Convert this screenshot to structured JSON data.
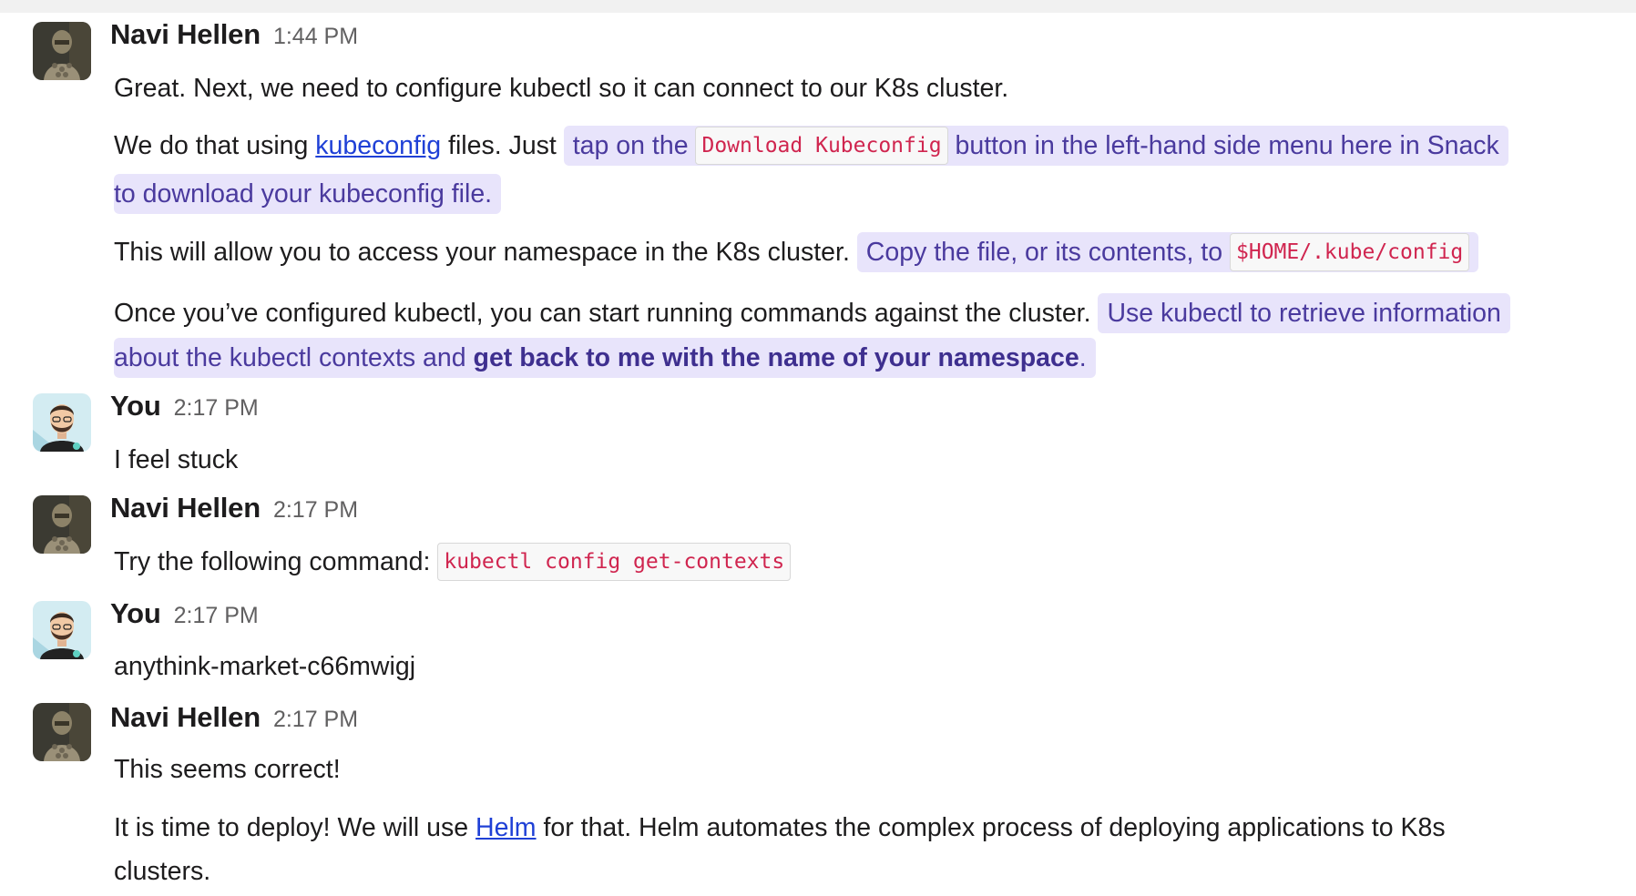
{
  "messages": [
    {
      "author": "Navi Hellen",
      "time": "1:44 PM",
      "lines": {
        "l1": "Great. Next, we need to configure kubectl so it can connect to our K8s cluster.",
        "l2a": "We do that using ",
        "l2link": "kubeconfig",
        "l2b": " files. Just ",
        "l2hl1": "tap on the ",
        "l2code": "Download Kubeconfig",
        "l2hl2": " button in the left-hand side menu here in Snack",
        "l3hl": "to download your kubeconfig file.",
        "l4a": "This will allow you to access your namespace in the K8s cluster. ",
        "l4hl": "Copy the file, or its contents, to ",
        "l4code": "$HOME/.kube/config",
        "l5a": "Once you’ve configured kubectl, you can start running commands against the cluster. ",
        "l5hl": "Use kubectl to retrieve information",
        "l6hl": "about the kubectl contexts and ",
        "l6bold": "get back to me with the name of your namespace",
        "l6end": "."
      }
    },
    {
      "author": "You",
      "time": "2:17 PM",
      "text": "I feel stuck"
    },
    {
      "author": "Navi Hellen",
      "time": "2:17 PM",
      "text": "Try the following command: ",
      "code": "kubectl config get-contexts"
    },
    {
      "author": "You",
      "time": "2:17 PM",
      "text": "anythink-market-c66mwigj"
    },
    {
      "author": "Navi Hellen",
      "time": "2:17 PM",
      "text": "This seems correct!",
      "p2a": "It is time to deploy! We will use ",
      "p2link": "Helm",
      "p2b": " for that. Helm automates the complex process of deploying applications to K8s",
      "p2c": "clusters."
    }
  ],
  "icons": {
    "bot_avatar": "robot-avatar-icon",
    "user_avatar": "user-avatar-icon"
  },
  "colors": {
    "highlight_bg": "#e8e4fb",
    "highlight_text": "#4a3a9e",
    "link": "#1f40d6",
    "code_text": "#d0254f"
  }
}
